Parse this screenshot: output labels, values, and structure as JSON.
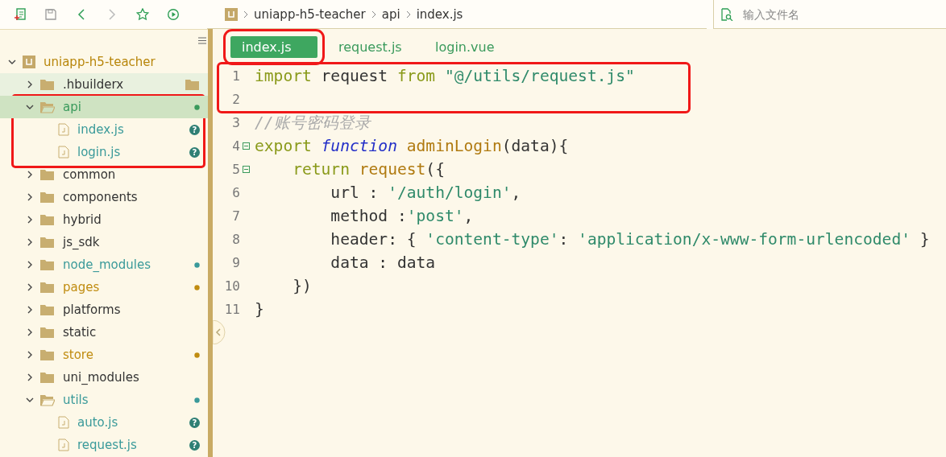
{
  "toolbar": {
    "breadcrumb": [
      "uniapp-h5-teacher",
      "api",
      "index.js"
    ],
    "search": {
      "placeholder": "输入文件名"
    }
  },
  "tree": [
    {
      "name": "uniapp-h5-teacher",
      "kind": "project",
      "expanded": true,
      "selected": false,
      "hovered": false,
      "dot": false,
      "color": "#b8860b",
      "children": [
        {
          "name": ".hbuilderx",
          "kind": "folder",
          "expanded": false,
          "selected": false,
          "hovered": true,
          "dot": false,
          "color": "#333333"
        },
        {
          "name": "api",
          "kind": "folder",
          "expanded": true,
          "selected": true,
          "hovered": false,
          "dot": true,
          "color": "#3a9a5c",
          "highlighted": true,
          "children": [
            {
              "name": "index.js",
              "kind": "file",
              "selected": false,
              "hovered": false,
              "dot": false,
              "color": "#3a9a9a",
              "badge": "?"
            },
            {
              "name": "login.js",
              "kind": "file",
              "selected": false,
              "hovered": false,
              "dot": false,
              "color": "#3a9a9a",
              "badge": "?"
            }
          ]
        },
        {
          "name": "common",
          "kind": "folder",
          "expanded": false,
          "selected": false,
          "hovered": false,
          "dot": false,
          "color": "#333333"
        },
        {
          "name": "components",
          "kind": "folder",
          "expanded": false,
          "selected": false,
          "hovered": false,
          "dot": false,
          "color": "#333333"
        },
        {
          "name": "hybrid",
          "kind": "folder",
          "expanded": false,
          "selected": false,
          "hovered": false,
          "dot": false,
          "color": "#333333"
        },
        {
          "name": "js_sdk",
          "kind": "folder",
          "expanded": false,
          "selected": false,
          "hovered": false,
          "dot": false,
          "color": "#333333"
        },
        {
          "name": "node_modules",
          "kind": "folder",
          "expanded": false,
          "selected": false,
          "hovered": false,
          "dot": true,
          "color": "#3a9a9a"
        },
        {
          "name": "pages",
          "kind": "folder",
          "expanded": false,
          "selected": false,
          "hovered": false,
          "dot": true,
          "color": "#c08c10"
        },
        {
          "name": "platforms",
          "kind": "folder",
          "expanded": false,
          "selected": false,
          "hovered": false,
          "dot": false,
          "color": "#333333"
        },
        {
          "name": "static",
          "kind": "folder",
          "expanded": false,
          "selected": false,
          "hovered": false,
          "dot": false,
          "color": "#333333"
        },
        {
          "name": "store",
          "kind": "folder",
          "expanded": false,
          "selected": false,
          "hovered": false,
          "dot": true,
          "color": "#c08c10"
        },
        {
          "name": "uni_modules",
          "kind": "folder",
          "expanded": false,
          "selected": false,
          "hovered": false,
          "dot": false,
          "color": "#333333"
        },
        {
          "name": "utils",
          "kind": "folder",
          "expanded": true,
          "selected": false,
          "hovered": false,
          "dot": true,
          "color": "#3a9a9a",
          "children": [
            {
              "name": "auto.js",
              "kind": "file",
              "selected": false,
              "hovered": false,
              "dot": false,
              "color": "#3a9a9a",
              "badge": "?"
            },
            {
              "name": "request.js",
              "kind": "file",
              "selected": false,
              "hovered": false,
              "dot": false,
              "color": "#3a9a9a",
              "badge": "?"
            }
          ]
        }
      ]
    }
  ],
  "tabs": [
    {
      "label": "index.js",
      "selected": true,
      "highlighted": true
    },
    {
      "label": "request.js",
      "selected": false
    },
    {
      "label": "login.vue",
      "selected": false
    }
  ],
  "code": [
    {
      "number": "1",
      "highlighted": true,
      "tokens": [
        {
          "kind": "keyword",
          "text": "import"
        },
        {
          "kind": "plain",
          "text": " request "
        },
        {
          "kind": "keyword",
          "text": "from "
        },
        {
          "kind": "string",
          "text": "\"@/utils/request.js\""
        }
      ]
    },
    {
      "number": "2",
      "highlighted": true
    },
    {
      "number": "3",
      "tokens": [
        {
          "kind": "comment",
          "text": "//账号密码登录"
        }
      ]
    },
    {
      "number": "4",
      "fold": true,
      "tokens": [
        {
          "kind": "keyword",
          "text": "export "
        },
        {
          "kind": "storage",
          "text": "function "
        },
        {
          "kind": "func",
          "text": "adminLogin"
        },
        {
          "kind": "plain",
          "text": "(data){"
        }
      ]
    },
    {
      "number": "5",
      "fold": true,
      "tokens": [
        {
          "kind": "keyword",
          "text": "    return "
        },
        {
          "kind": "func",
          "text": "request"
        },
        {
          "kind": "plain",
          "text": "({"
        }
      ]
    },
    {
      "number": "6",
      "tokens": [
        {
          "kind": "plain",
          "text": "        url : "
        },
        {
          "kind": "string",
          "text": "'/auth/login'"
        },
        {
          "kind": "plain",
          "text": ","
        }
      ]
    },
    {
      "number": "7",
      "tokens": [
        {
          "kind": "plain",
          "text": "        method :"
        },
        {
          "kind": "string",
          "text": "'post'"
        },
        {
          "kind": "plain",
          "text": ","
        }
      ]
    },
    {
      "number": "8",
      "tokens": [
        {
          "kind": "plain",
          "text": "        header: { "
        },
        {
          "kind": "string",
          "text": "'content-type'"
        },
        {
          "kind": "plain",
          "text": ": "
        },
        {
          "kind": "string",
          "text": "'application/x-www-form-urlencoded'"
        },
        {
          "kind": "plain",
          "text": " }"
        }
      ]
    },
    {
      "number": "9",
      "tokens": [
        {
          "kind": "plain",
          "text": "        data : data"
        }
      ]
    },
    {
      "number": "10",
      "tokens": [
        {
          "kind": "plain",
          "text": "    })"
        }
      ]
    },
    {
      "number": "11",
      "tokens": [
        {
          "kind": "plain",
          "text": "}"
        }
      ]
    }
  ]
}
